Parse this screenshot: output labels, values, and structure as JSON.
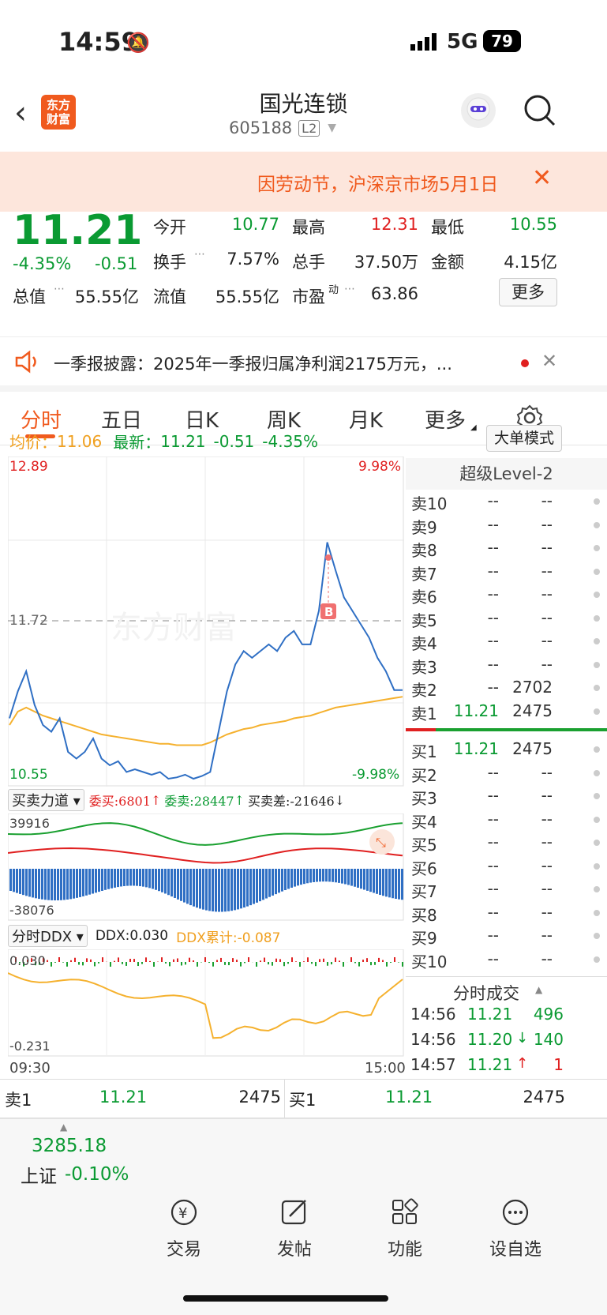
{
  "status": {
    "time": "14:59",
    "network": "5G",
    "battery": "79"
  },
  "header": {
    "title": "国光连锁",
    "code": "605188",
    "level_badge": "L2",
    "logo_text": "东方\n财富"
  },
  "notice": {
    "text": "因劳动节，沪深京市场5月1日"
  },
  "quote": {
    "price": "11.21",
    "pct": "-4.35%",
    "chg": "-0.51",
    "open_label": "今开",
    "open": "10.77",
    "high_label": "最高",
    "high": "12.31",
    "low_label": "最低",
    "low": "10.55",
    "turnover_label": "换手",
    "turnover": "7.57%",
    "volume_label": "总手",
    "volume": "37.50万",
    "amount_label": "金额",
    "amount": "4.15亿",
    "mcap_label": "总值",
    "mcap": "55.55亿",
    "float_label": "流值",
    "float": "55.55亿",
    "pe_label": "市盈",
    "pe_sup": "动",
    "pe": "63.86",
    "more_btn": "更多"
  },
  "announcement": {
    "text": "一季报披露：2025年一季报归属净利润2175万元，..."
  },
  "tabs": [
    "分时",
    "五日",
    "日K",
    "周K",
    "月K",
    "更多"
  ],
  "info_line": {
    "avg_label": "均价：",
    "avg": "11.06",
    "latest_label": "最新：",
    "latest": "11.21",
    "chg": "-0.51",
    "pct": "-4.35%",
    "mode_btn": "大单模式"
  },
  "chart_labels": {
    "top_price": "12.89",
    "top_pct": "9.98%",
    "mid_price": "11.72",
    "bot_price": "10.55",
    "bot_pct": "-9.98%",
    "watermark": "东方财富",
    "marker": "B"
  },
  "force": {
    "selector": "买卖力道",
    "bid_label": "委买:6801",
    "ask_label": "委卖:28447",
    "diff_label": "买卖差:-21646",
    "top": "39916",
    "bottom": "-38076"
  },
  "ddx": {
    "selector": "分时DDX",
    "ddx": "DDX:0.030",
    "cum": "DDX累计:-0.087",
    "top": "0.030",
    "bottom": "-0.231",
    "start_time": "09:30",
    "end_time": "15:00"
  },
  "level2": {
    "title": "超级Level-2",
    "sells": [
      {
        "l": "卖10",
        "p": "--",
        "v": "--"
      },
      {
        "l": "卖9",
        "p": "--",
        "v": "--"
      },
      {
        "l": "卖8",
        "p": "--",
        "v": "--"
      },
      {
        "l": "卖7",
        "p": "--",
        "v": "--"
      },
      {
        "l": "卖6",
        "p": "--",
        "v": "--"
      },
      {
        "l": "卖5",
        "p": "--",
        "v": "--"
      },
      {
        "l": "卖4",
        "p": "--",
        "v": "--"
      },
      {
        "l": "卖3",
        "p": "--",
        "v": "--"
      },
      {
        "l": "卖2",
        "p": "--",
        "v": "2702"
      },
      {
        "l": "卖1",
        "p": "11.21",
        "v": "2475"
      }
    ],
    "buys": [
      {
        "l": "买1",
        "p": "11.21",
        "v": "2475"
      },
      {
        "l": "买2",
        "p": "--",
        "v": "--"
      },
      {
        "l": "买3",
        "p": "--",
        "v": "--"
      },
      {
        "l": "买4",
        "p": "--",
        "v": "--"
      },
      {
        "l": "买5",
        "p": "--",
        "v": "--"
      },
      {
        "l": "买6",
        "p": "--",
        "v": "--"
      },
      {
        "l": "买7",
        "p": "--",
        "v": "--"
      },
      {
        "l": "买8",
        "p": "--",
        "v": "--"
      },
      {
        "l": "买9",
        "p": "--",
        "v": "--"
      },
      {
        "l": "买10",
        "p": "--",
        "v": "--"
      }
    ],
    "trades_title": "分时成交",
    "trades": [
      {
        "t": "14:56",
        "p": "11.21",
        "a": "",
        "v": "496"
      },
      {
        "t": "14:56",
        "p": "11.20",
        "a": "↓",
        "v": "140"
      },
      {
        "t": "14:57",
        "p": "11.21",
        "a": "↑",
        "v": "1"
      }
    ]
  },
  "bottom_quote": {
    "sell_label": "卖1",
    "sell_price": "11.21",
    "sell_vol": "2475",
    "buy_label": "买1",
    "buy_price": "11.21",
    "buy_vol": "2475"
  },
  "nav": {
    "index_value": "3285.18",
    "index_name": "上证",
    "index_pct": "-0.10%",
    "items": [
      "交易",
      "发帖",
      "功能",
      "设自选"
    ]
  },
  "chart_data": {
    "type": "line",
    "x_range": [
      "09:30",
      "15:00"
    ],
    "ylim": [
      10.55,
      12.89
    ],
    "series": [
      {
        "name": "",
        "values": [
          11.0,
          11.2,
          11.35,
          11.1,
          10.95,
          10.9,
          11.0,
          10.75,
          10.7,
          10.75,
          10.85,
          10.7,
          10.65,
          10.68,
          10.6,
          10.62,
          10.6,
          10.58,
          10.6,
          10.55,
          10.56,
          10.58,
          10.55,
          10.57,
          10.6,
          10.9,
          11.2,
          11.4,
          11.5,
          11.45,
          11.5,
          11.55,
          11.5,
          11.6,
          11.65,
          11.55,
          11.55,
          11.8,
          12.31,
          12.1,
          11.9,
          11.8,
          11.7,
          11.6,
          11.45,
          11.35,
          11.21,
          11.21
        ]
      },
      {
        "name": "均价",
        "values": [
          10.95,
          11.05,
          11.08,
          11.05,
          11.02,
          11.0,
          10.98,
          10.96,
          10.94,
          10.92,
          10.9,
          10.88,
          10.87,
          10.86,
          10.85,
          10.84,
          10.83,
          10.82,
          10.81,
          10.81,
          10.8,
          10.8,
          10.8,
          10.8,
          10.82,
          10.85,
          10.88,
          10.9,
          10.92,
          10.93,
          10.95,
          10.96,
          10.97,
          10.98,
          11.0,
          11.01,
          11.02,
          11.04,
          11.06,
          11.08,
          11.09,
          11.1,
          11.11,
          11.12,
          11.13,
          11.14,
          11.15,
          11.16
        ]
      }
    ],
    "ylabel": "",
    "xlabel": ""
  }
}
